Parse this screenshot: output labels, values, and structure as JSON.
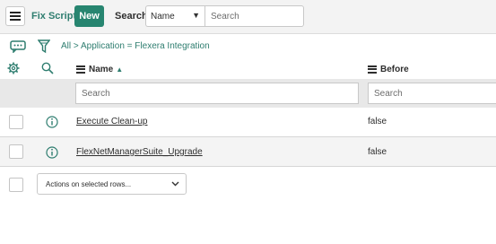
{
  "header": {
    "title": "Fix Scripts",
    "new_label": "New",
    "search_label": "Search",
    "search_field": "Name",
    "search_placeholder": "Search"
  },
  "breadcrumb": {
    "all": "All",
    "separator": ">",
    "condition": "Application = Flexera Integration"
  },
  "columns": {
    "name": "Name",
    "before": "Before"
  },
  "filter": {
    "name_placeholder": "Search",
    "before_placeholder": "Search"
  },
  "rows": [
    {
      "name": "Execute Clean-up",
      "before": "false"
    },
    {
      "name": "FlexNetManagerSuite_Upgrade",
      "before": "false"
    }
  ],
  "footer": {
    "actions_label": "Actions on selected rows..."
  },
  "colors": {
    "accent": "#278570",
    "accent_text": "#2e7d6f"
  }
}
